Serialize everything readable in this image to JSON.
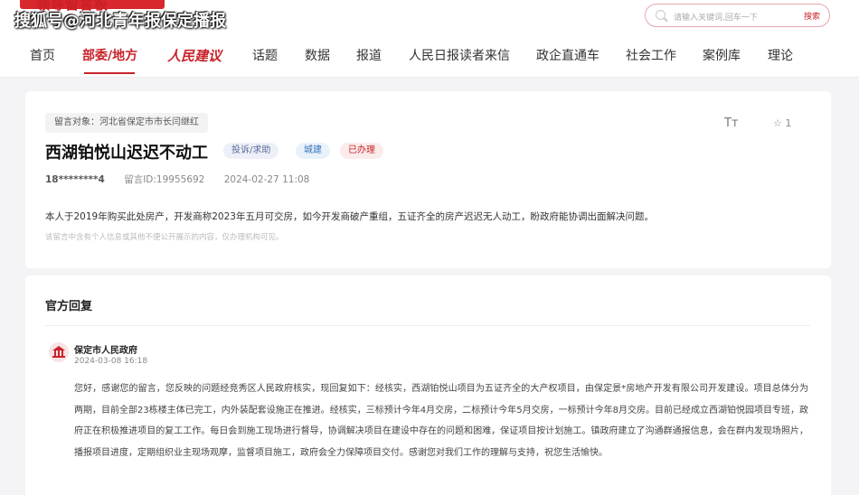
{
  "watermark": "搜狐号@河北青年报保定播报",
  "site": {
    "logo_text": "领导留言板"
  },
  "search": {
    "placeholder": "请输入关键词,回车一下",
    "button_label": "搜索"
  },
  "nav": {
    "items": [
      "首页",
      "部委/地方",
      "人民建议",
      "话题",
      "数据",
      "报道",
      "人民日报读者来信",
      "政企直通车",
      "社会工作",
      "案例库",
      "理论"
    ],
    "active": "部委/地方"
  },
  "message": {
    "target": "留言对象：河北省保定市市长闫继红",
    "title": "西湖铂悦山迟迟不动工",
    "tags": [
      "投诉/求助",
      "城建",
      "已办理"
    ],
    "user": "18********4",
    "id": "留言ID:19955692",
    "datetime": "2024-02-27 11:08",
    "font_icon": "Tт",
    "favorite_count": "☆ 1",
    "content": "本人于2019年购买此处房产，开发商称2023年五月可交房，如今开发商破产重组，五证齐全的房产迟迟无人动工，盼政府能协调出面解决问题。",
    "privacy_note": "该留言中含有个人信息或其他不便公开展示的内容，仅办理机构可见。"
  },
  "reply": {
    "heading": "官方回复",
    "org": "保定市人民政府",
    "datetime": "2024-03-08 16:18",
    "body": "您好，感谢您的留言，您反映的问题经竞秀区人民政府核实，现回复如下：经核实，西湖铂悦山项目为五证齐全的大产权项目，由保定景*房地产开发有限公司开发建设。项目总体分为两期，目前全部23栋楼主体已完工，内外装配套设施正在推进。经核实，三标预计今年4月交房，二标预计今年5月交房，一标预计今年8月交房。目前已经成立西湖铂悦园项目专班，政府正在积极推进项目的复工工作。每日会到施工现场进行督导，协调解决项目在建设中存在的问题和困难，保证项目按计划施工。镇政府建立了沟通群通报信息，会在群内发现场照片，播报项目进度，定期组织业主现场观摩，监督项目施工，政府会全力保障项目交付。感谢您对我们工作的理解与支持，祝您生活愉快。"
  },
  "colors": {
    "accent": "#c8232a",
    "background": "#f4f4f6"
  }
}
